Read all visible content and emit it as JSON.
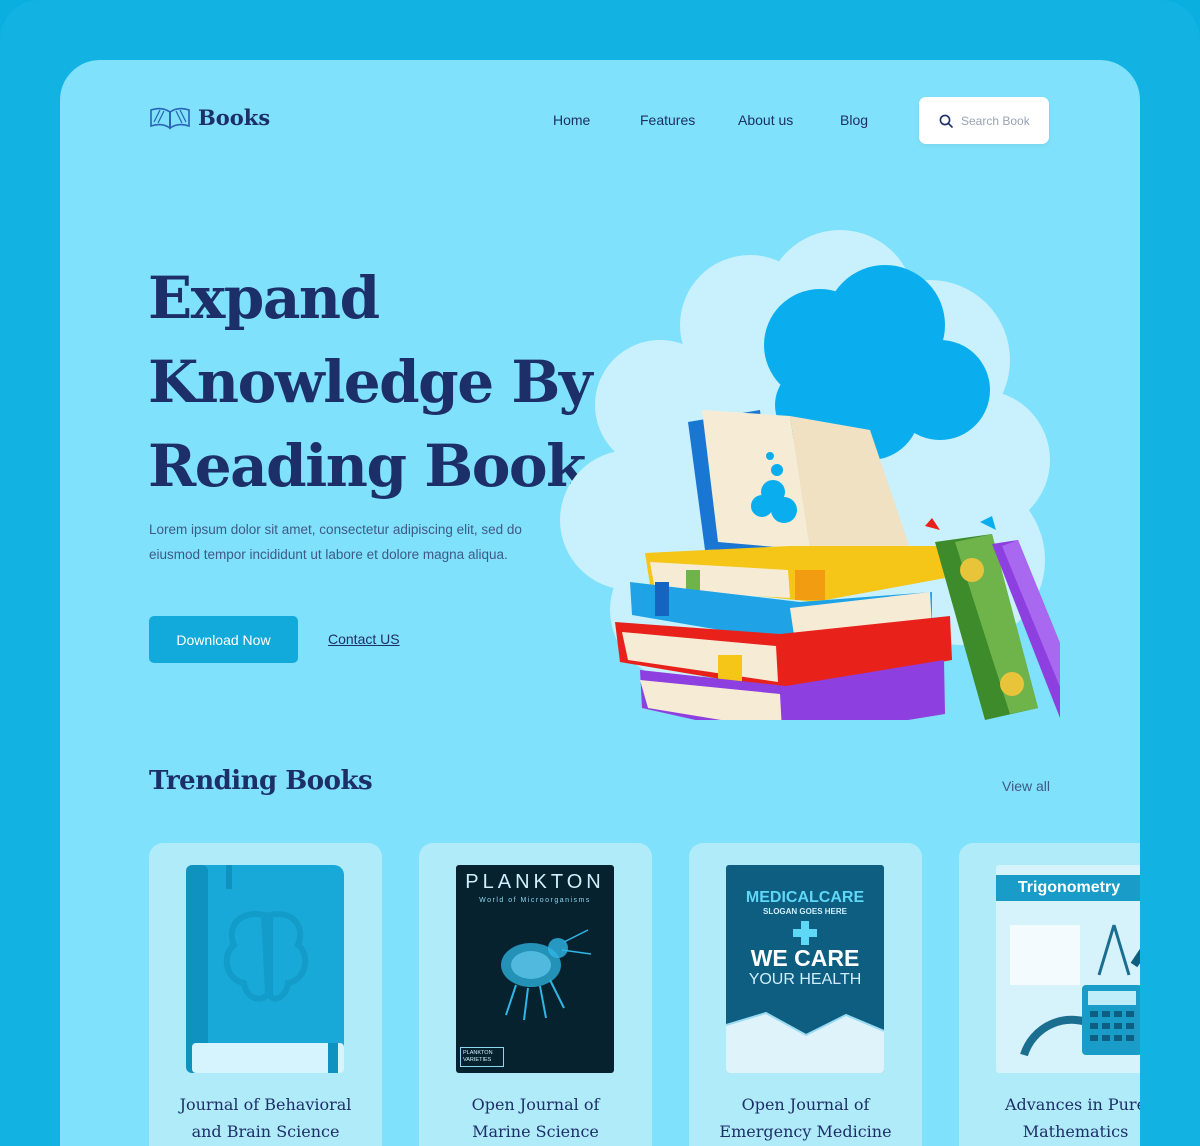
{
  "app": {
    "brand": "Books"
  },
  "nav": {
    "items": [
      {
        "label": "Home"
      },
      {
        "label": "Features"
      },
      {
        "label": "About us"
      },
      {
        "label": "Blog"
      }
    ]
  },
  "search": {
    "placeholder": "Search Book"
  },
  "hero": {
    "title_lines": [
      "Expand",
      "Knowledge By",
      "Reading Book"
    ],
    "description": "Lorem ipsum dolor sit amet, consectetur adipiscing elit, sed do eiusmod tempor incididunt ut labore et dolore magna aliqua.",
    "primary_button": "Download Now",
    "secondary_link": "Contact US"
  },
  "trending": {
    "title": "Trending Books",
    "view_all": "View all",
    "books": [
      {
        "title_lines": [
          "Journal of Behavioral",
          "and Brain Science"
        ],
        "cover_icon": "brain-book-icon"
      },
      {
        "title_lines": [
          "Open Journal of",
          "Marine Science"
        ],
        "cover": {
          "title": "PLANKTON",
          "subtitle": "World of Microorganisms",
          "badge": "PLANKTON VARIETIES"
        }
      },
      {
        "title_lines": [
          "Open Journal of",
          "Emergency Medicine"
        ],
        "cover": {
          "title": "MEDICALCARE",
          "subtitle": "SLOGAN GOES HERE",
          "line1": "WE CARE",
          "line2": "YOUR HEALTH"
        }
      },
      {
        "title_lines": [
          "Advances in Pure",
          "Mathematics"
        ],
        "cover": {
          "title": "Trigonometry"
        }
      }
    ]
  },
  "colors": {
    "outer_bg": "#12b3e3",
    "panel_bg": "#7fe1fb",
    "card_bg": "#b0ebfa",
    "text_dark": "#1d2f68",
    "accent": "#12aadb"
  }
}
